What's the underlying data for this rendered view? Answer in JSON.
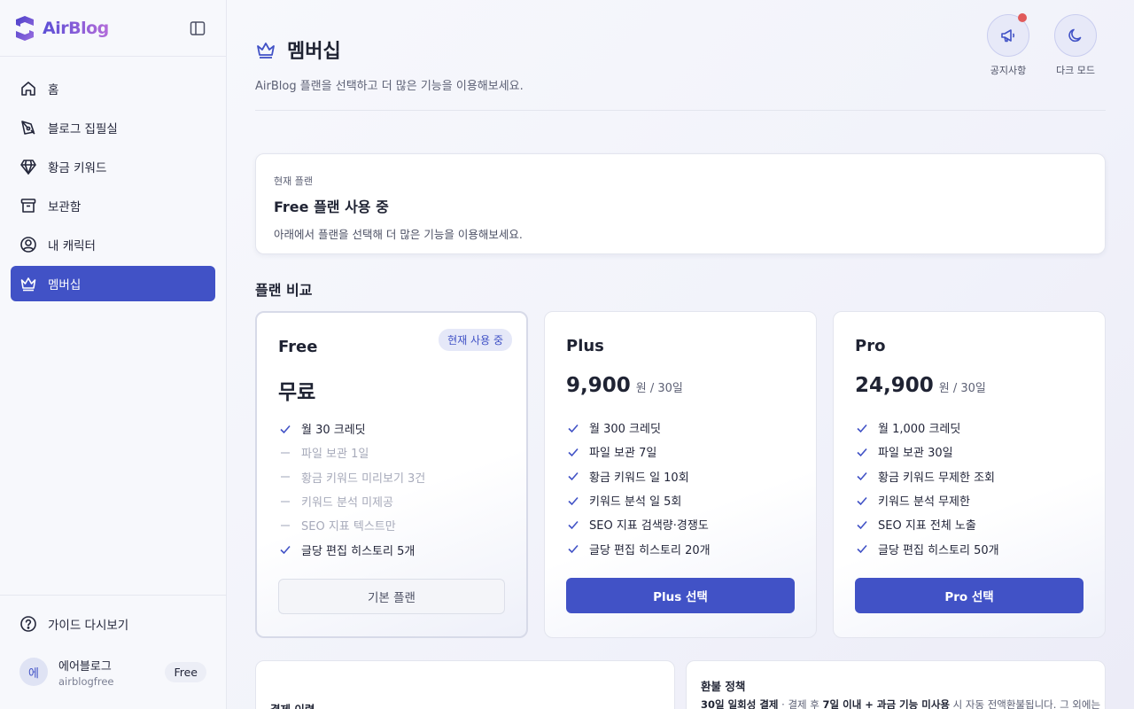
{
  "app": {
    "name": "AirBlog"
  },
  "sidebar": {
    "items": [
      {
        "label": "홈",
        "icon": "home-icon"
      },
      {
        "label": "블로그 집필실",
        "icon": "pen-icon"
      },
      {
        "label": "황금 키워드",
        "icon": "gem-icon"
      },
      {
        "label": "보관함",
        "icon": "archive-icon"
      },
      {
        "label": "내 캐릭터",
        "icon": "user-circle-icon"
      },
      {
        "label": "멤버십",
        "icon": "crown-icon",
        "active": true
      }
    ],
    "guide": "가이드 다시보기",
    "user": {
      "avatar": "에",
      "name": "에어블로그",
      "id": "airblogfree",
      "plan": "Free"
    }
  },
  "header": {
    "title": "멤버십",
    "subtitle": "AirBlog 플랜을 선택하고 더 많은 기능을 이용해보세요.",
    "actions": {
      "notice": "공지사항",
      "dark": "다크 모드"
    }
  },
  "current_plan": {
    "label": "현재 플랜",
    "title": "Free 플랜 사용 중",
    "desc": "아래에서 플랜을 선택해 더 많은 기능을 이용해보세요."
  },
  "compare": {
    "title": "플랜 비교",
    "plans": [
      {
        "name": "Free",
        "price": "무료",
        "unit": "",
        "badge": "현재 사용 중",
        "features": [
          {
            "text": "월 30 크레딧",
            "on": true
          },
          {
            "text": "파일 보관 1일",
            "on": false
          },
          {
            "text": "황금 키워드 미리보기 3건",
            "on": false
          },
          {
            "text": "키워드 분석 미제공",
            "on": false
          },
          {
            "text": "SEO 지표 텍스트만",
            "on": false
          },
          {
            "text": "글당 편집 히스토리 5개",
            "on": true
          }
        ],
        "button": "기본 플랜"
      },
      {
        "name": "Plus",
        "price": "9,900",
        "unit": "원 / 30일",
        "features": [
          {
            "text": "월 300 크레딧",
            "on": true
          },
          {
            "text": "파일 보관 7일",
            "on": true
          },
          {
            "text": "황금 키워드 일 10회",
            "on": true
          },
          {
            "text": "키워드 분석 일 5회",
            "on": true
          },
          {
            "text": "SEO 지표 검색량·경쟁도",
            "on": true
          },
          {
            "text": "글당 편집 히스토리 20개",
            "on": true
          }
        ],
        "button": "Plus 선택"
      },
      {
        "name": "Pro",
        "price": "24,900",
        "unit": "원 / 30일",
        "features": [
          {
            "text": "월 1,000 크레딧",
            "on": true
          },
          {
            "text": "파일 보관 30일",
            "on": true
          },
          {
            "text": "황금 키워드 무제한 조회",
            "on": true
          },
          {
            "text": "키워드 분석 무제한",
            "on": true
          },
          {
            "text": "SEO 지표 전체 노출",
            "on": true
          },
          {
            "text": "글당 편집 히스토리 50개",
            "on": true
          }
        ],
        "button": "Pro 선택"
      }
    ]
  },
  "payment_history": {
    "title": "결제 이력"
  },
  "refund": {
    "title": "환불 정책",
    "p1": "30일 일회성 결제",
    "p2": " · 결제 후 ",
    "p3": "7일 이내 + 과금 기능 미사용",
    "p4": " 시 자동 전액환불됩니다. 그 외에는 디"
  },
  "colors": {
    "accent": "#4152c6",
    "notice_dot": "#e15a5a",
    "text": "#1f2333"
  }
}
